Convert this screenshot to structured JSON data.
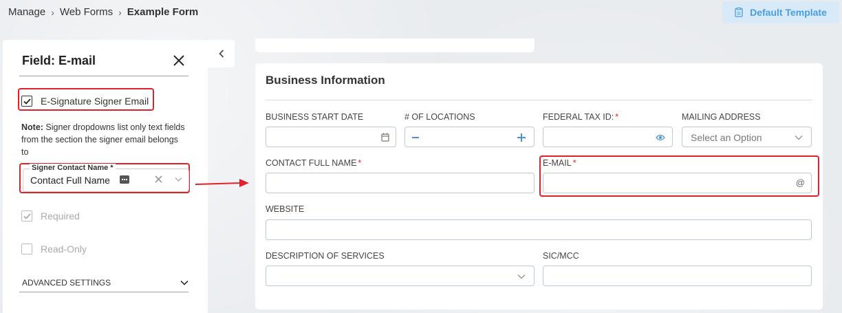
{
  "breadcrumb": {
    "items": [
      "Manage",
      "Web Forms"
    ],
    "current": "Example Form"
  },
  "toolbar": {
    "template_button": "Default Template"
  },
  "field_panel": {
    "title": "Field: E-mail",
    "esign_checkbox": {
      "label": "E-Signature Signer Email",
      "checked": true
    },
    "note_bold": "Note:",
    "note_text": " Signer dropdowns list only text fields from the section the signer email belongs to",
    "signer_select": {
      "label": "Signer Contact Name *",
      "value": "Contact Full Name"
    },
    "required": {
      "label": "Required",
      "checked": true,
      "disabled": true
    },
    "read_only": {
      "label": "Read-Only",
      "checked": false,
      "disabled": true
    },
    "advanced": "ADVANCED SETTINGS"
  },
  "form": {
    "section_title": "Business Information",
    "fields": {
      "business_start_date": "BUSINESS START DATE",
      "num_locations": "# OF LOCATIONS",
      "federal_tax_id": "FEDERAL TAX ID:",
      "mailing_address": "MAILING ADDRESS",
      "mailing_address_placeholder": "Select an Option",
      "contact_full_name": "CONTACT FULL NAME",
      "email": "E-MAIL",
      "website": "WEBSITE",
      "description_of_services": "DESCRIPTION OF SERVICES",
      "sic_mcc": "SIC/MCC"
    },
    "required_mark": "*"
  },
  "colors": {
    "highlight": "#e0202a",
    "accent": "#4a90d9",
    "template_button_bg": "#d8e9f7"
  }
}
